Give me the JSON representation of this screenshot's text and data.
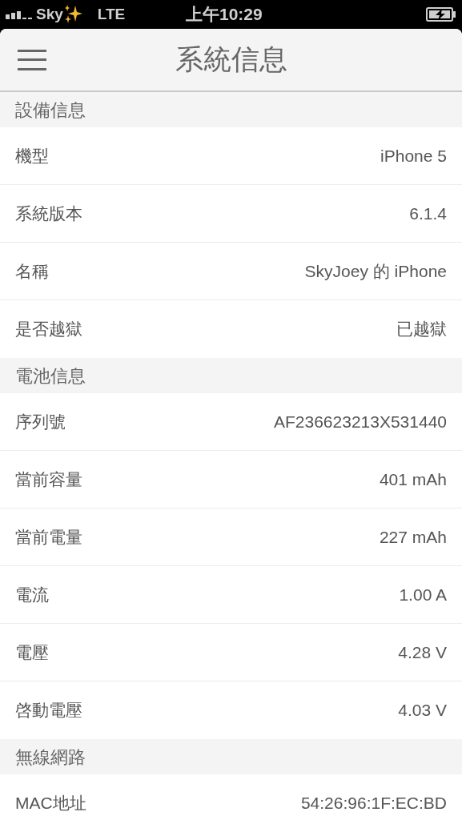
{
  "status_bar": {
    "carrier": "Sky",
    "network": "LTE",
    "time": "上午10:29"
  },
  "header": {
    "title": "系統信息"
  },
  "sections": [
    {
      "title": "設備信息",
      "rows": [
        {
          "label": "機型",
          "value": "iPhone 5"
        },
        {
          "label": "系統版本",
          "value": "6.1.4"
        },
        {
          "label": "名稱",
          "value": "SkyJoey 的 iPhone"
        },
        {
          "label": "是否越獄",
          "value": "已越獄"
        }
      ]
    },
    {
      "title": "電池信息",
      "rows": [
        {
          "label": "序列號",
          "value": "AF236623213X531440"
        },
        {
          "label": "當前容量",
          "value": "401 mAh"
        },
        {
          "label": "當前電量",
          "value": "227 mAh"
        },
        {
          "label": "電流",
          "value": "1.00 A"
        },
        {
          "label": "電壓",
          "value": "4.28 V"
        },
        {
          "label": "啓動電壓",
          "value": "4.03 V"
        }
      ]
    },
    {
      "title": "無線網路",
      "rows": [
        {
          "label": "MAC地址",
          "value": "54:26:96:1F:EC:BD"
        }
      ]
    }
  ]
}
